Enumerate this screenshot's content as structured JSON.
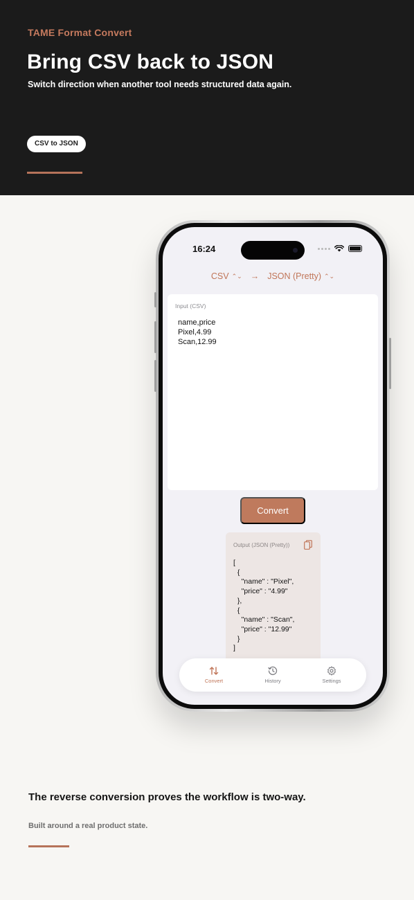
{
  "hero": {
    "brand": "TAME Format Convert",
    "title": "Bring CSV back to JSON",
    "subtitle": "Switch direction when another tool needs structured data again.",
    "pill": "CSV to JSON"
  },
  "phone": {
    "status_time": "16:24",
    "source_format": "CSV",
    "target_format": "JSON (Pretty)",
    "arrow": "→",
    "input_label": "Input (CSV)",
    "input_text": "name,price\nPixel,4.99\nScan,12.99",
    "convert_label": "Convert",
    "output_label": "Output (JSON (Pretty))",
    "output_text": "[\n  {\n    \"name\" : \"Pixel\",\n    \"price\" : \"4.99\"\n  },\n  {\n    \"name\" : \"Scan\",\n    \"price\" : \"12.99\"\n  }\n]",
    "tabs": [
      {
        "label": "Convert",
        "icon": "convert-arrows-icon",
        "active": true
      },
      {
        "label": "History",
        "icon": "clock-history-icon",
        "active": false
      },
      {
        "label": "Settings",
        "icon": "gear-icon",
        "active": false
      }
    ]
  },
  "footer": {
    "title": "The reverse conversion proves the workflow is two-way.",
    "subtitle": "Built around a real product state."
  },
  "colors": {
    "accent": "#c07558",
    "hero_bg": "#1b1b1b",
    "page_bg": "#f7f6f3",
    "screen_bg": "#f2f1f6"
  }
}
